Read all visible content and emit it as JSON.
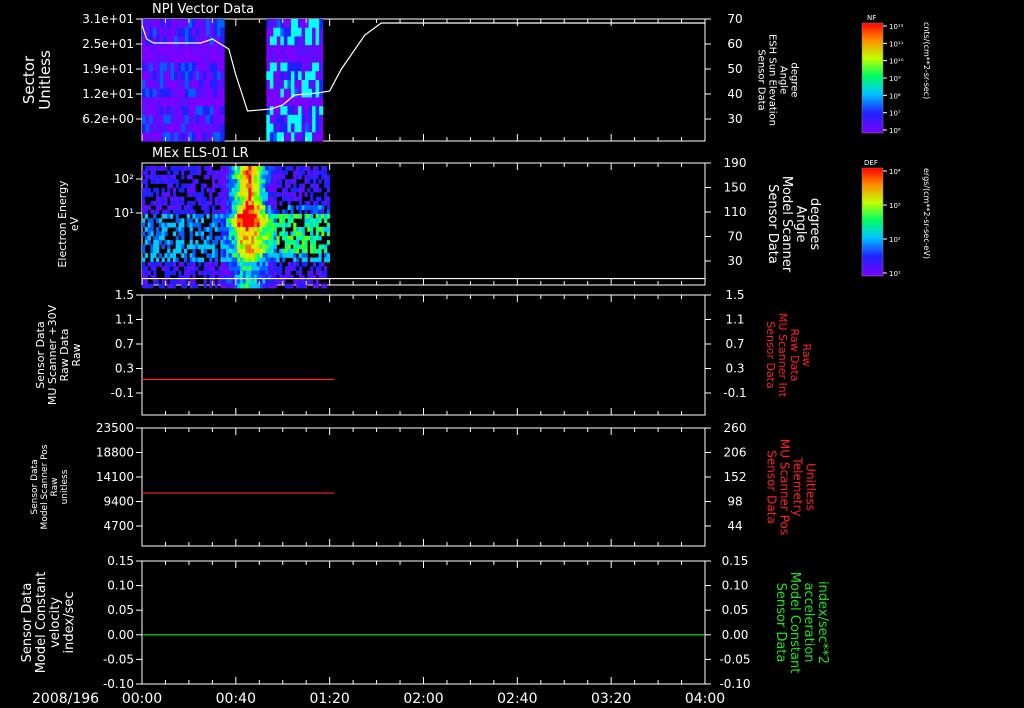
{
  "date_label": "2008/196",
  "time_ticks": [
    "00:00",
    "00:40",
    "01:20",
    "02:00",
    "02:40",
    "03:20",
    "04:00"
  ],
  "colors": {
    "background": "#000000",
    "axis": "#ffffff",
    "red_trace": "#ff2020",
    "green_trace": "#20e020"
  },
  "colorbars": [
    {
      "label": "NF",
      "unit": "cnts/(cm**2-sr-sec)",
      "ticks": [
        "10¹²",
        "10¹¹",
        "10¹⁰",
        "10⁹",
        "10⁸",
        "10⁷",
        "10⁶"
      ]
    },
    {
      "label": "DEF",
      "unit": "ergs/(cm**2-sr-sec-eV)",
      "ticks": [
        "10⁴",
        "10³",
        "10²",
        "10¹"
      ]
    }
  ],
  "chart_data": [
    {
      "type": "heatmap",
      "title": "NPI Vector Data",
      "ylabel": [
        "Sector",
        "Unitless"
      ],
      "y_ticks": [
        "3.1e+01",
        "2.5e+01",
        "1.9e+01",
        "1.2e+01",
        "6.2e+00"
      ],
      "right_ylabel": [
        "Sensor Data",
        "ESH Sun Elevation",
        "Angle",
        "degree"
      ],
      "right_ticks": [
        "70",
        "60",
        "50",
        "40",
        "30"
      ],
      "right_ylim": [
        20,
        70
      ],
      "overlay_line": {
        "x_minutes": [
          0,
          2,
          5,
          25,
          30,
          37,
          40,
          45,
          55,
          60,
          65,
          75,
          80,
          85,
          95,
          102,
          108,
          115,
          240
        ],
        "y_degree": [
          67,
          60,
          58,
          58,
          60,
          55,
          42,
          24,
          25,
          27,
          32,
          33,
          34,
          45,
          62,
          68,
          68,
          68,
          68
        ]
      },
      "data_blocks_minutes": [
        [
          0,
          35
        ],
        [
          53,
          77
        ]
      ]
    },
    {
      "type": "heatmap",
      "title": "MEx ELS-01 LR",
      "ylabel": [
        "Electron Energy",
        "eV"
      ],
      "y_ticks": [
        "10²",
        "10¹"
      ],
      "right_ylabel": [
        "Sensor Data",
        "Model Scanner",
        "Angle",
        "degrees"
      ],
      "right_ticks": [
        "190",
        "150",
        "110",
        "70",
        "30"
      ],
      "right_ylim": [
        0,
        190
      ],
      "overlay_line": {
        "x_minutes": [
          0,
          240
        ],
        "y_degree": [
          10,
          10
        ]
      },
      "data_blocks_minutes": [
        [
          0,
          80
        ]
      ],
      "peak_minutes": 45
    },
    {
      "type": "line",
      "ylabel": [
        "Sensor Data",
        "MU Scanner +30V",
        "Raw Data",
        "Raw"
      ],
      "y_ticks": [
        "1.5",
        "1.1",
        "0.7",
        "0.3",
        "-0.1"
      ],
      "ylim": [
        -0.3,
        1.5
      ],
      "right_ylabel": [
        "Sensor Data",
        "MU Scanner Int",
        "Raw Data",
        "Raw"
      ],
      "right_ticks": [
        "1.5",
        "1.1",
        "0.7",
        "0.3",
        "-0.1"
      ],
      "series": [
        {
          "x_minutes": [
            0,
            82
          ],
          "y": [
            -0.05,
            -0.05
          ],
          "color": "#ff2020"
        }
      ]
    },
    {
      "type": "line",
      "ylabel": [
        "Sensor Data",
        "Model Scanner Pos",
        "Raw",
        "unitless"
      ],
      "y_ticks": [
        "23500",
        "18800",
        "14100",
        "9400",
        "4700"
      ],
      "ylim": [
        0,
        23500
      ],
      "right_ylabel": [
        "Sensor Data",
        "MU Scanner Pos",
        "Telemetry",
        "Unitless"
      ],
      "right_ticks": [
        "260",
        "206",
        "152",
        "98",
        "44"
      ],
      "series": [
        {
          "x_minutes": [
            0,
            82
          ],
          "y": [
            7900,
            7900
          ],
          "color": "#ff2020"
        }
      ]
    },
    {
      "type": "line",
      "ylabel": [
        "Sensor Data",
        "Model Constant",
        "velocity",
        "index/sec"
      ],
      "y_ticks": [
        "0.15",
        "0.10",
        "0.05",
        "0.00",
        "-0.05",
        "-0.10"
      ],
      "ylim": [
        -0.1,
        0.15
      ],
      "right_ylabel": [
        "Sensor Data",
        "Model Constant",
        "acceleration",
        "index/sec**2"
      ],
      "right_ticks": [
        "0.15",
        "0.10",
        "0.05",
        "0.00",
        "-0.05",
        "-0.10"
      ],
      "series": [
        {
          "x_minutes": [
            0,
            240
          ],
          "y": [
            0.0,
            0.0
          ],
          "color": "#20e020"
        }
      ]
    }
  ]
}
